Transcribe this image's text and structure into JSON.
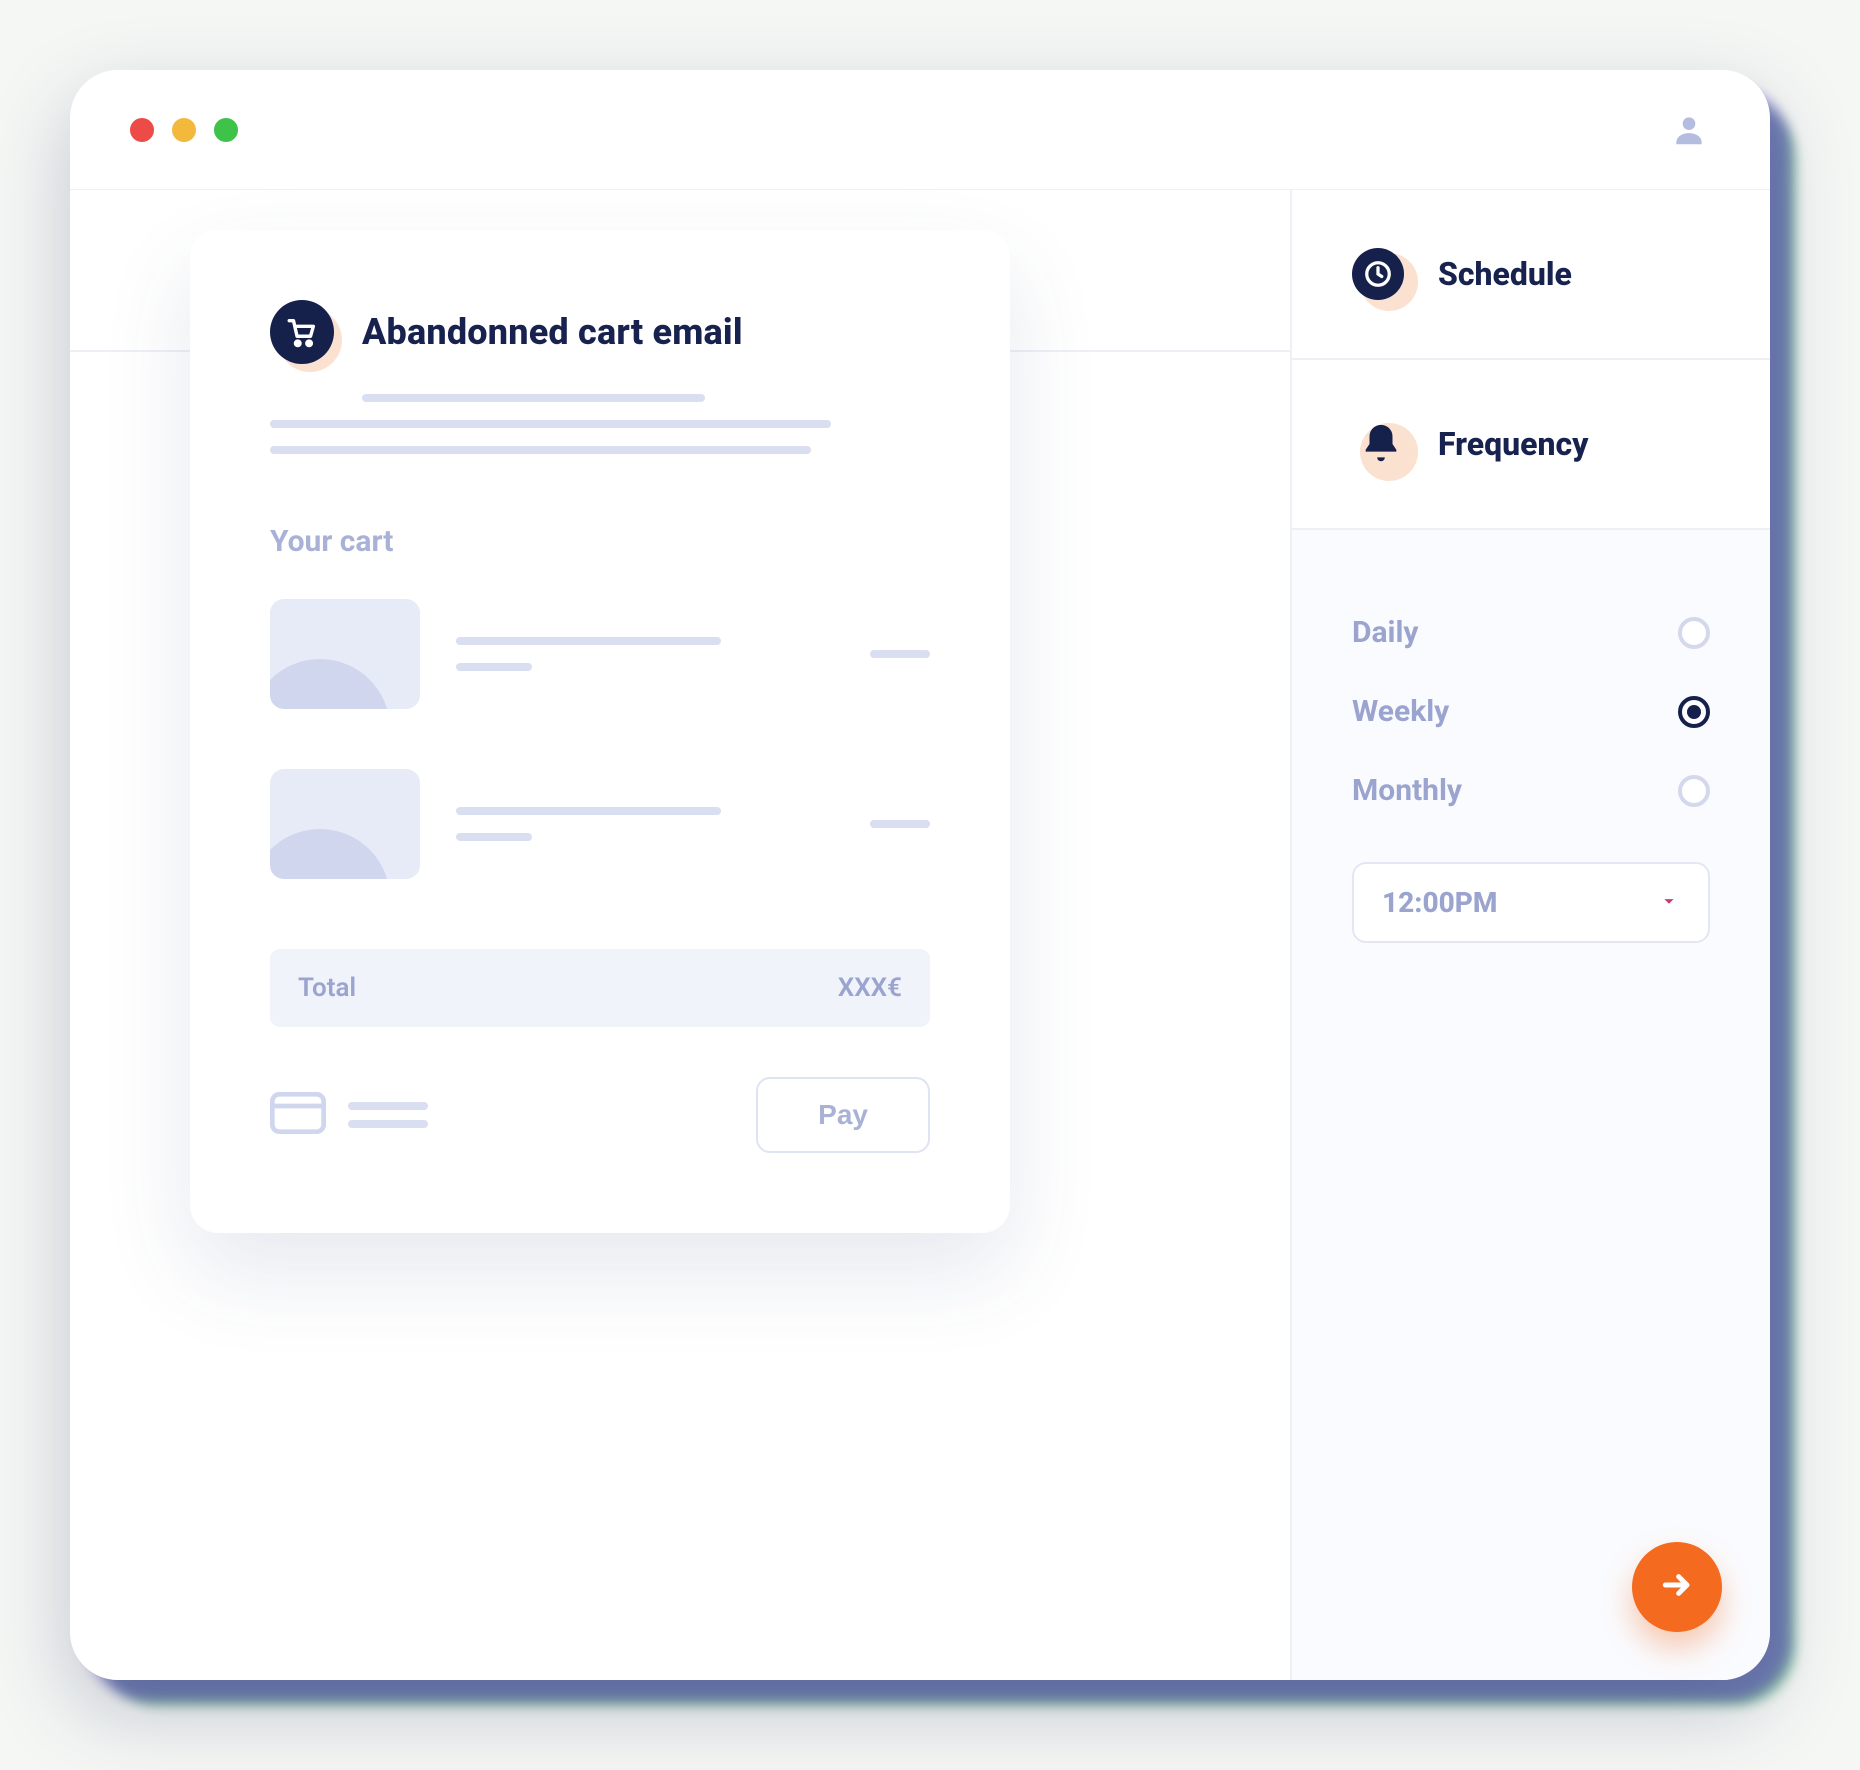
{
  "email_card": {
    "title": "Abandonned cart email",
    "your_cart_label": "Your cart",
    "total_label": "Total",
    "total_value": "XXX€",
    "pay_button": "Pay"
  },
  "sidebar": {
    "schedule_label": "Schedule",
    "frequency_label": "Frequency",
    "frequency_options": [
      {
        "label": "Daily",
        "selected": false
      },
      {
        "label": "Weekly",
        "selected": true
      },
      {
        "label": "Monthly",
        "selected": false
      }
    ],
    "time_value": "12:00PM"
  },
  "icons": {
    "cart": "cart-icon",
    "clock": "clock-icon",
    "bell": "bell-icon",
    "user": "user-icon",
    "credit_card": "credit-card-icon",
    "chevron_down": "chevron-down-icon",
    "arrow_right": "arrow-right-icon"
  },
  "colors": {
    "navy": "#15214b",
    "accent_orange": "#f46a1f",
    "muted": "#9aa4cf",
    "halo": "#fbe1cf"
  }
}
